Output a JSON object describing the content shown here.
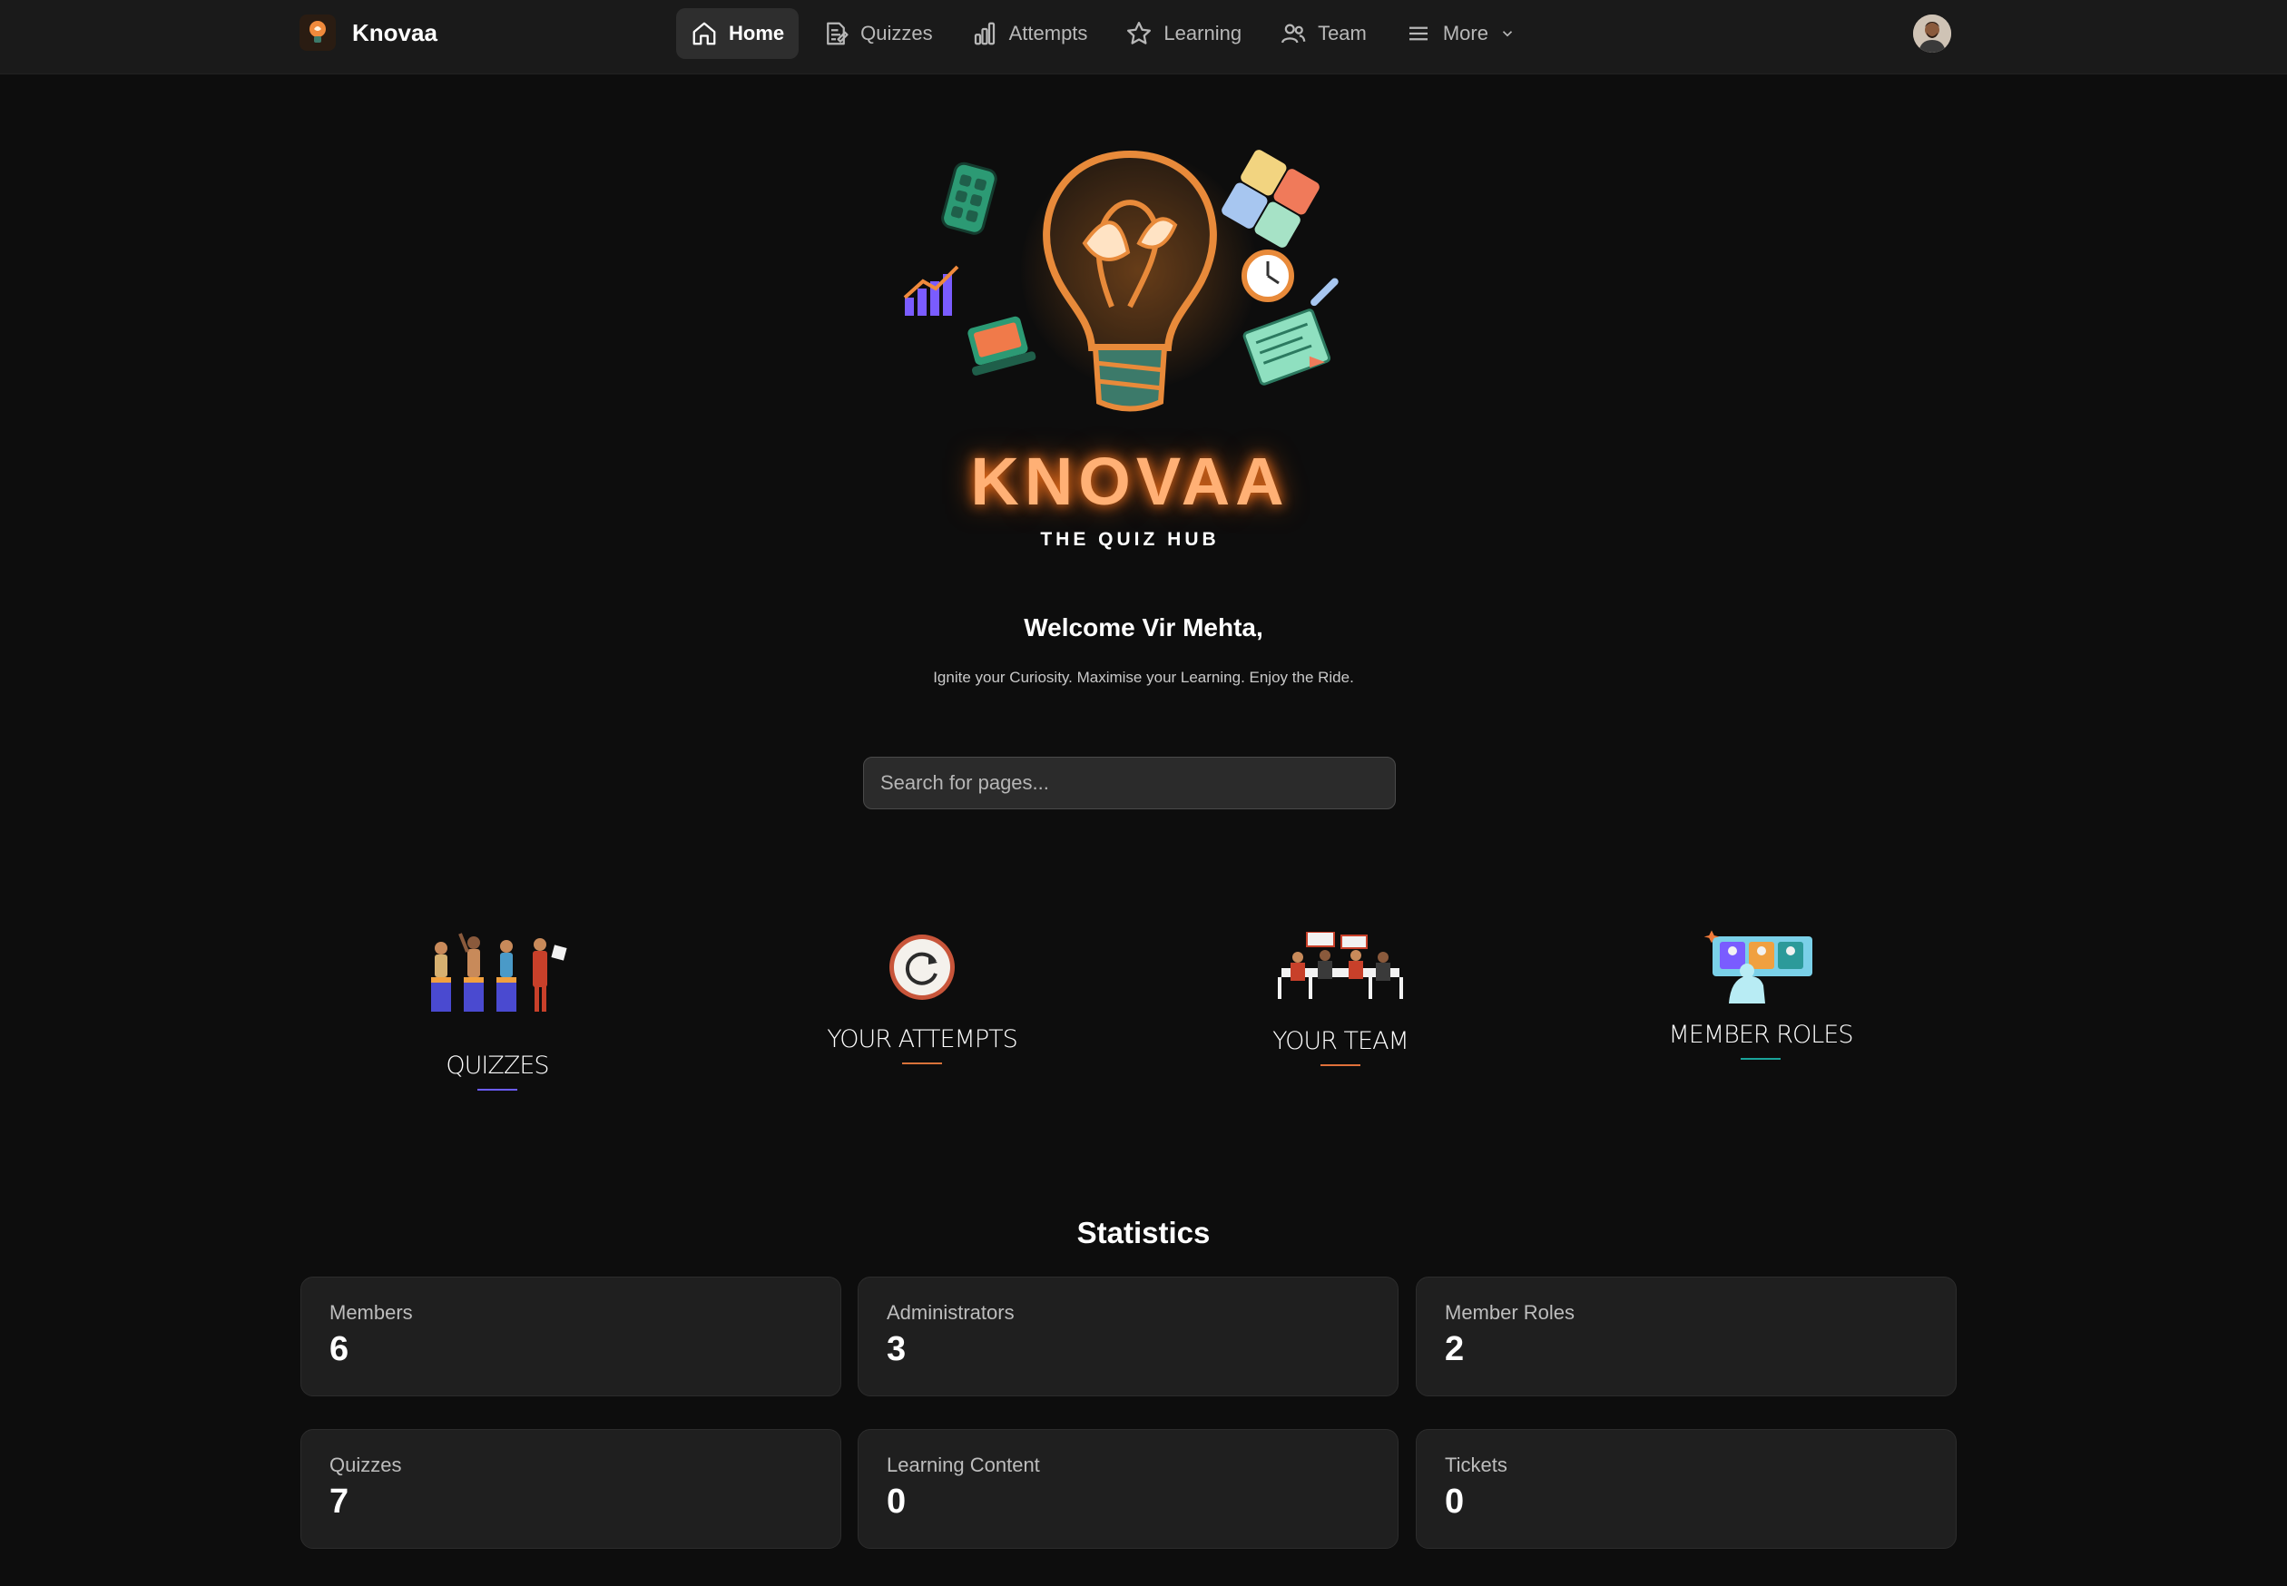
{
  "app": {
    "name": "Knovaa",
    "hero_title": "KNOVAA",
    "hero_tagline": "THE QUIZ HUB"
  },
  "nav": {
    "items": [
      {
        "label": "Home",
        "icon": "home-icon",
        "active": true
      },
      {
        "label": "Quizzes",
        "icon": "document-icon",
        "active": false
      },
      {
        "label": "Attempts",
        "icon": "bar-chart-icon",
        "active": false
      },
      {
        "label": "Learning",
        "icon": "star-icon",
        "active": false
      },
      {
        "label": "Team",
        "icon": "users-icon",
        "active": false
      },
      {
        "label": "More",
        "icon": "menu-icon",
        "active": false
      }
    ]
  },
  "welcome": {
    "greeting": "Welcome Vir Mehta,",
    "subtitle": "Ignite your Curiosity. Maximise your Learning. Enjoy the Ride."
  },
  "search": {
    "placeholder": "Search for pages..."
  },
  "features": [
    {
      "label": "QUIZZES",
      "accent": "#6b5cff"
    },
    {
      "label": "YOUR ATTEMPTS",
      "accent": "#d9733a"
    },
    {
      "label": "YOUR TEAM",
      "accent": "#e0703a"
    },
    {
      "label": "MEMBER ROLES",
      "accent": "#1aa39a"
    }
  ],
  "statistics": {
    "title": "Statistics",
    "cards": [
      {
        "label": "Members",
        "value": "6"
      },
      {
        "label": "Administrators",
        "value": "3"
      },
      {
        "label": "Member Roles",
        "value": "2"
      },
      {
        "label": "Quizzes",
        "value": "7"
      },
      {
        "label": "Learning Content",
        "value": "0"
      },
      {
        "label": "Tickets",
        "value": "0"
      }
    ]
  },
  "colors": {
    "background": "#0d0d0d",
    "nav_background": "#1a1a1a",
    "card_background": "#1f1f1f",
    "hero_glow": "#ffb075"
  }
}
